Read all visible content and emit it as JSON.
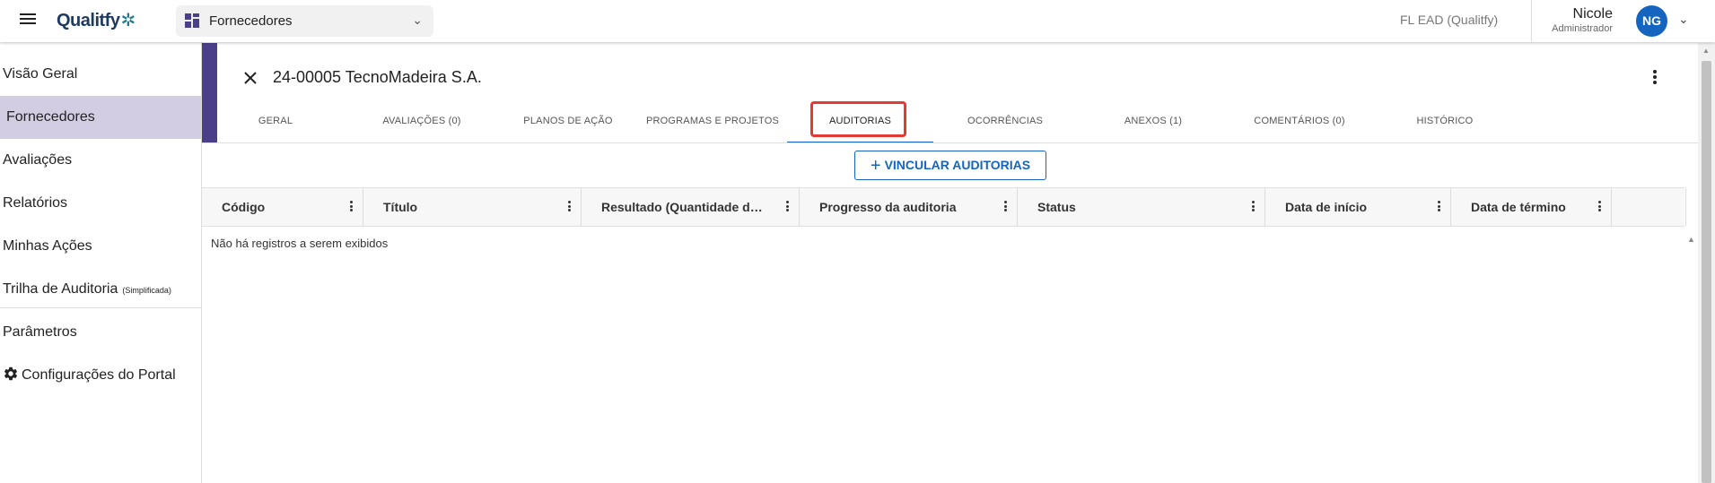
{
  "topbar": {
    "menu_icon": "hamburger-menu-icon",
    "logo_text": "Qualitfy",
    "logo_mark": "✲",
    "module": {
      "label": "Fornecedores",
      "icon": "grid-apps-icon",
      "chevron": "⌄"
    },
    "tenant": "FL EAD (Qualitfy)",
    "user": {
      "name": "Nicole",
      "role": "Administrador",
      "initials": "NG",
      "avatar_color": "#1565c0"
    },
    "user_chevron": "⌄"
  },
  "sidebar": {
    "items": [
      {
        "label": "Visão Geral"
      },
      {
        "label": "Fornecedores",
        "active": true
      },
      {
        "label": "Avaliações"
      },
      {
        "label": "Relatórios"
      },
      {
        "label": "Minhas Ações"
      },
      {
        "label": "Trilha de Auditoria",
        "small": "(Simplificada)"
      },
      {
        "label": "Parâmetros"
      },
      {
        "label": "Configurações do Portal",
        "icon": "gear-icon"
      }
    ],
    "active_color": "#d3cde3",
    "accent_color": "#4b3f8a"
  },
  "record": {
    "title": "24-00005 TecnoMadeira S.A.",
    "close_icon": "close-icon",
    "more_icon": "more-vert-icon"
  },
  "tabs": [
    {
      "label": "GERAL"
    },
    {
      "label": "AVALIAÇÕES (0)"
    },
    {
      "label": "PLANOS DE AÇÃO"
    },
    {
      "label": "PROGRAMAS E PROJETOS"
    },
    {
      "label": "AUDITORIAS",
      "active": true
    },
    {
      "label": "OCORRÊNCIAS"
    },
    {
      "label": "ANEXOS (1)"
    },
    {
      "label": "COMENTÁRIOS (0)"
    },
    {
      "label": "HISTÓRICO"
    }
  ],
  "actions": {
    "link_button": "VINCULAR AUDITORIAS",
    "link_icon": "+"
  },
  "grid": {
    "columns": [
      {
        "label": "Código"
      },
      {
        "label": "Título"
      },
      {
        "label": "Resultado (Quantidade de pontos)"
      },
      {
        "label": "Progresso da auditoria"
      },
      {
        "label": "Status"
      },
      {
        "label": "Data de início"
      },
      {
        "label": "Data de término"
      },
      {
        "label": ""
      }
    ],
    "empty_message": "Não há registros a serem exibidos"
  },
  "colors": {
    "primary": "#1565c0",
    "highlight": "#e53935"
  }
}
